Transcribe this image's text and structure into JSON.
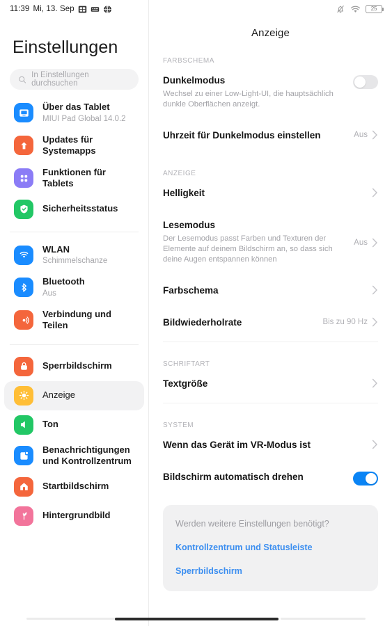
{
  "status_bar": {
    "clock": "11:39",
    "date": "Mi, 13. Sep",
    "left_icons": [
      "screenshot-icon",
      "keyboard-icon",
      "globe-icon"
    ],
    "right_icons": [
      "bell-muted-icon",
      "wifi-icon",
      "battery-icon"
    ],
    "battery_level": "25"
  },
  "sidebar": {
    "title": "Einstellungen",
    "search": {
      "placeholder": "In Einstellungen durchsuchen",
      "icon": "search-icon"
    },
    "groups": [
      {
        "items": [
          {
            "label": "Über das Tablet",
            "sub": "MIUI Pad Global 14.0.2",
            "icon": "tablet-icon",
            "color": "#1A8CFF",
            "active": false
          },
          {
            "label": "Updates für Systemapps",
            "sub": "",
            "icon": "update-arrow-icon",
            "color": "#F4663C",
            "active": false
          },
          {
            "label": "Funktionen für Tablets",
            "sub": "",
            "icon": "grid-dots-icon",
            "color": "#8B7CF6",
            "active": false
          },
          {
            "label": "Sicherheitsstatus",
            "sub": "",
            "icon": "shield-check-icon",
            "color": "#22C765",
            "active": false
          }
        ]
      },
      {
        "items": [
          {
            "label": "WLAN",
            "sub": "Schimmelschanze",
            "icon": "wifi-icon",
            "color": "#1A8CFF",
            "active": false
          },
          {
            "label": "Bluetooth",
            "sub": "Aus",
            "icon": "bluetooth-icon",
            "color": "#1A8CFF",
            "active": false
          },
          {
            "label": "Verbindung und Teilen",
            "sub": "",
            "icon": "share-signal-icon",
            "color": "#F4663C",
            "active": false
          }
        ]
      },
      {
        "items": [
          {
            "label": "Sperrbildschirm",
            "sub": "",
            "icon": "lock-icon",
            "color": "#F4663C",
            "active": false
          },
          {
            "label": "Anzeige",
            "sub": "",
            "icon": "brightness-sun-icon",
            "color": "#FFBE36",
            "active": true
          },
          {
            "label": "Ton",
            "sub": "",
            "icon": "speaker-icon",
            "color": "#22C765",
            "active": false
          },
          {
            "label": "Benachrichtigungen und Kontrollzentrum",
            "sub": "",
            "icon": "notification-icon",
            "color": "#1A8CFF",
            "active": false
          },
          {
            "label": "Startbildschirm",
            "sub": "",
            "icon": "home-icon",
            "color": "#F4663C",
            "active": false
          },
          {
            "label": "Hintergrundbild",
            "sub": "",
            "icon": "wallpaper-flower-icon",
            "color": "#F2749B",
            "active": false
          }
        ]
      }
    ]
  },
  "detail": {
    "title": "Anzeige",
    "sections": [
      {
        "head": "FARBSCHEMA",
        "rows": [
          {
            "title": "Dunkelmodus",
            "desc": "Wechsel zu einer Low-Light-UI, die hauptsächlich dunkle Oberflächen anzeigt.",
            "control": "toggle",
            "toggle_on": false,
            "value": ""
          },
          {
            "title": "Uhrzeit für Dunkelmodus einstellen",
            "desc": "",
            "control": "chevron",
            "value": "Aus"
          }
        ]
      },
      {
        "head": "ANZEIGE",
        "rows": [
          {
            "title": "Helligkeit",
            "desc": "",
            "control": "chevron",
            "value": ""
          },
          {
            "title": "Lesemodus",
            "desc": "Der Lesemodus passt Farben und Texturen der Elemente auf deinem Bildschirm an, so dass sich deine Augen entspannen können",
            "control": "chevron",
            "value": "Aus"
          },
          {
            "title": "Farbschema",
            "desc": "",
            "control": "chevron",
            "value": ""
          },
          {
            "title": "Bildwiederholrate",
            "desc": "",
            "control": "chevron",
            "value": "Bis zu 90 Hz"
          }
        ]
      },
      {
        "head": "SCHRIFTART",
        "rows": [
          {
            "title": "Textgröße",
            "desc": "",
            "control": "chevron",
            "value": ""
          }
        ]
      },
      {
        "head": "SYSTEM",
        "rows": [
          {
            "title": "Wenn das Gerät im VR-Modus ist",
            "desc": "",
            "control": "chevron",
            "value": ""
          },
          {
            "title": "Bildschirm automatisch drehen",
            "desc": "",
            "control": "toggle",
            "toggle_on": true,
            "value": ""
          }
        ]
      }
    ],
    "suggestion_card": {
      "question": "Werden weitere Einstellungen benötigt?",
      "links": [
        "Kontrollzentrum und Statusleiste",
        "Sperrbildschirm"
      ],
      "link_color": "#3b8ef0"
    }
  }
}
